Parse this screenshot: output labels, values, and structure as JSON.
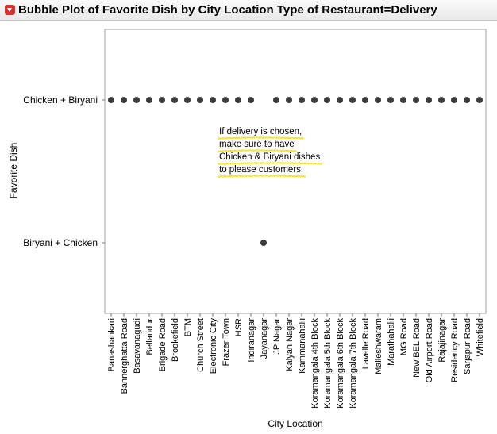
{
  "header": {
    "title": "Bubble Plot of Favorite Dish by City Location Type of Restaurant=Delivery",
    "menu_icon": "red-triangle-menu-icon"
  },
  "annotation": {
    "lines": [
      "If delivery is chosen,",
      "make sure to have",
      "Chicken & Biryani dishes",
      "to please customers."
    ],
    "underline_color": "#f5e53c"
  },
  "colors": {
    "marker": "#3c3c3c"
  },
  "chart_data": {
    "type": "scatter",
    "title": "",
    "xlabel": "City Location",
    "ylabel": "Favorite Dish",
    "grid": false,
    "categories": [
      "Banashankari",
      "Bannerghatta Road",
      "Basavanagudi",
      "Bellandur",
      "Brigade Road",
      "Brookefield",
      "BTM",
      "Church Street",
      "Electronic City",
      "Frazer Town",
      "HSR",
      "Indiranagar",
      "Jayanagar",
      "JP Nagar",
      "Kalyan Nagar",
      "Kammanahalli",
      "Koramangala 4th Block",
      "Koramangala 5th Block",
      "Koramangala 6th Block",
      "Koramangala 7th Block",
      "Lavelle Road",
      "Malleshwaram",
      "Marathahalli",
      "MG Road",
      "New BEL Road",
      "Old Airport Road",
      "Rajajinagar",
      "Residency Road",
      "Sarjapur Road",
      "Whitefield"
    ],
    "y_categories": [
      "Chicken + Biryani",
      "Biryani + Chicken"
    ],
    "points": [
      {
        "x": "Banashankari",
        "y": "Chicken + Biryani"
      },
      {
        "x": "Bannerghatta Road",
        "y": "Chicken + Biryani"
      },
      {
        "x": "Basavanagudi",
        "y": "Chicken + Biryani"
      },
      {
        "x": "Bellandur",
        "y": "Chicken + Biryani"
      },
      {
        "x": "Brigade Road",
        "y": "Chicken + Biryani"
      },
      {
        "x": "Brookefield",
        "y": "Chicken + Biryani"
      },
      {
        "x": "BTM",
        "y": "Chicken + Biryani"
      },
      {
        "x": "Church Street",
        "y": "Chicken + Biryani"
      },
      {
        "x": "Electronic City",
        "y": "Chicken + Biryani"
      },
      {
        "x": "Frazer Town",
        "y": "Chicken + Biryani"
      },
      {
        "x": "HSR",
        "y": "Chicken + Biryani"
      },
      {
        "x": "Indiranagar",
        "y": "Chicken + Biryani"
      },
      {
        "x": "Jayanagar",
        "y": "Biryani + Chicken"
      },
      {
        "x": "JP Nagar",
        "y": "Chicken + Biryani"
      },
      {
        "x": "Kalyan Nagar",
        "y": "Chicken + Biryani"
      },
      {
        "x": "Kammanahalli",
        "y": "Chicken + Biryani"
      },
      {
        "x": "Koramangala 4th Block",
        "y": "Chicken + Biryani"
      },
      {
        "x": "Koramangala 5th Block",
        "y": "Chicken + Biryani"
      },
      {
        "x": "Koramangala 6th Block",
        "y": "Chicken + Biryani"
      },
      {
        "x": "Koramangala 7th Block",
        "y": "Chicken + Biryani"
      },
      {
        "x": "Lavelle Road",
        "y": "Chicken + Biryani"
      },
      {
        "x": "Malleshwaram",
        "y": "Chicken + Biryani"
      },
      {
        "x": "Marathahalli",
        "y": "Chicken + Biryani"
      },
      {
        "x": "MG Road",
        "y": "Chicken + Biryani"
      },
      {
        "x": "New BEL Road",
        "y": "Chicken + Biryani"
      },
      {
        "x": "Old Airport Road",
        "y": "Chicken + Biryani"
      },
      {
        "x": "Rajajinagar",
        "y": "Chicken + Biryani"
      },
      {
        "x": "Residency Road",
        "y": "Chicken + Biryani"
      },
      {
        "x": "Sarjapur Road",
        "y": "Chicken + Biryani"
      },
      {
        "x": "Whitefield",
        "y": "Chicken + Biryani"
      }
    ]
  }
}
